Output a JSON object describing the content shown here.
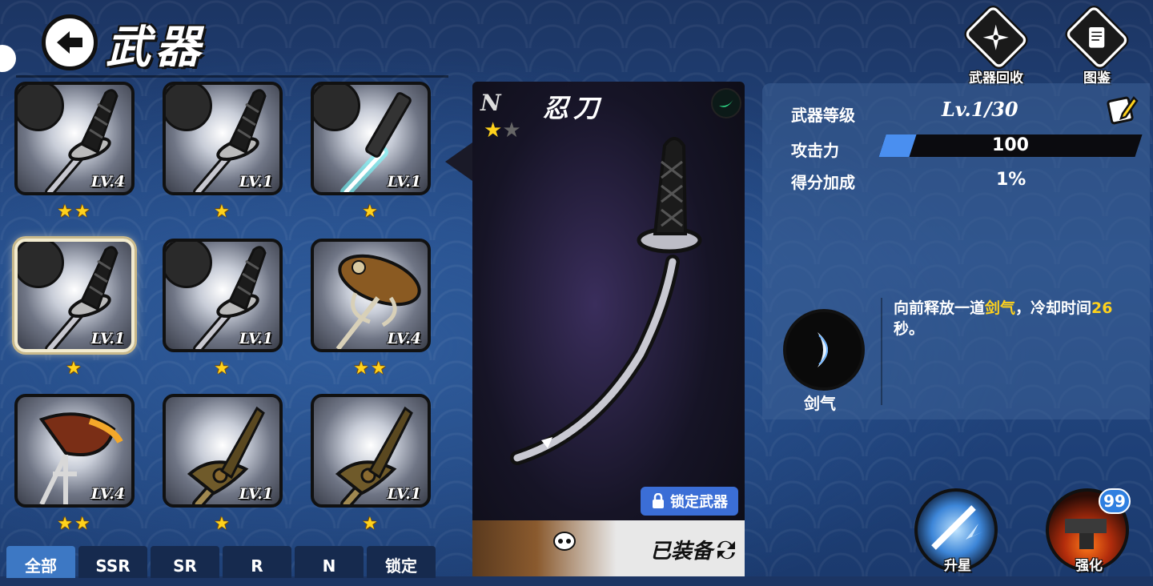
{
  "header": {
    "title": "武器",
    "recycle_label": "武器回收",
    "collection_label": "图鉴"
  },
  "grid": {
    "cards": [
      {
        "level": "LV.4",
        "stars": "★★",
        "weapon": "katana",
        "selected": false
      },
      {
        "level": "LV.1",
        "stars": "★",
        "weapon": "katana",
        "selected": false
      },
      {
        "level": "LV.1",
        "stars": "★",
        "weapon": "lightsaber",
        "selected": false
      },
      {
        "level": "LV.1",
        "stars": "★",
        "weapon": "katana",
        "selected": true
      },
      {
        "level": "LV.1",
        "stars": "★",
        "weapon": "katana",
        "selected": false
      },
      {
        "level": "LV.4",
        "stars": "★★",
        "weapon": "fish-trident",
        "selected": false
      },
      {
        "level": "LV.4",
        "stars": "★★",
        "weapon": "sweet-potato-fork",
        "selected": false
      },
      {
        "level": "LV.1",
        "stars": "★",
        "weapon": "bronze-sword",
        "selected": false
      },
      {
        "level": "LV.1",
        "stars": "★",
        "weapon": "bronze-sword",
        "selected": false
      }
    ]
  },
  "tabs": [
    "全部",
    "SSR",
    "SR",
    "R",
    "N",
    "锁定"
  ],
  "detail": {
    "rarity": "N",
    "name": "忍刀",
    "lock_label": "锁定武器",
    "equipped_label": "已装备"
  },
  "stats": {
    "level_label": "武器等级",
    "level_value": "Lv.1/30",
    "attack_label": "攻击力",
    "attack_value": "100",
    "attack_fill_percent": 12,
    "score_label": "得分加成",
    "score_value": "1%"
  },
  "skill": {
    "name": "剑气",
    "desc_part1": "向前释放一道",
    "desc_highlight1": "剑气",
    "desc_part2": "，冷却时间",
    "desc_highlight2": "26",
    "desc_part3": "秒。"
  },
  "actions": {
    "starup_label": "升星",
    "enhance_label": "强化",
    "enhance_badge": "99"
  },
  "colors": {
    "accent": "#3b6ed6",
    "star": "#ffd21c",
    "active_tab": "#3d78c4"
  }
}
